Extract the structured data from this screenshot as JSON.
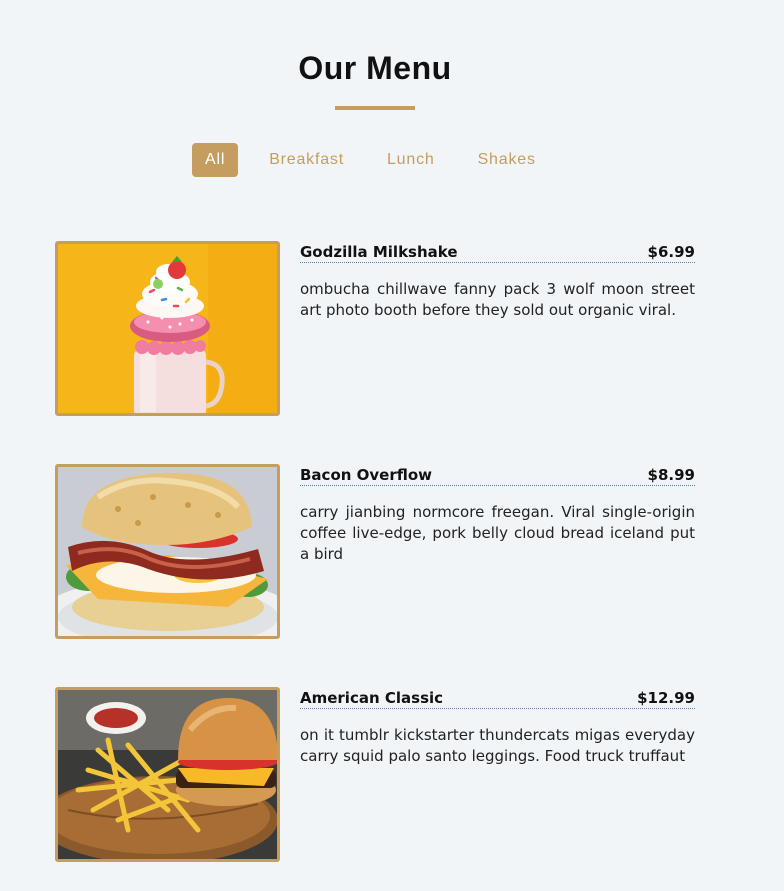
{
  "header": {
    "title": "Our Menu"
  },
  "filters": [
    {
      "label": "All",
      "active": true
    },
    {
      "label": "Breakfast",
      "active": false
    },
    {
      "label": "Lunch",
      "active": false
    },
    {
      "label": "Shakes",
      "active": false
    }
  ],
  "items": [
    {
      "title": "Godzilla Milkshake",
      "price": "$6.99",
      "desc": "ombucha chillwave fanny pack 3 wolf moon street art photo booth before they sold out organic viral.",
      "image_icon": "milkshake-photo"
    },
    {
      "title": "Bacon Overflow",
      "price": "$8.99",
      "desc": "carry jianbing normcore freegan. Viral single-origin coffee live-edge, pork belly cloud bread iceland put a bird",
      "image_icon": "bacon-sandwich-photo"
    },
    {
      "title": "American Classic",
      "price": "$12.99",
      "desc": "on it tumblr kickstarter thundercats migas everyday carry squid palo santo leggings. Food truck truffaut",
      "image_icon": "burger-fries-photo"
    }
  ],
  "colors": {
    "accent": "#c59d5f",
    "background": "#f1f5f8",
    "text": "#111111"
  }
}
